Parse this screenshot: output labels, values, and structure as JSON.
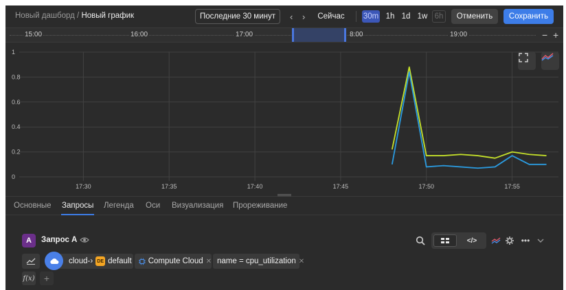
{
  "breadcrumb": {
    "parent": "Новый дашборд",
    "separator": " / ",
    "current": "Новый график"
  },
  "toolbar": {
    "range_label": "Последние 30 минут",
    "now_label": "Сейчас",
    "scales": [
      {
        "label": "30m",
        "state": "active"
      },
      {
        "label": "1h",
        "state": "on"
      },
      {
        "label": "1d",
        "state": "on"
      },
      {
        "label": "1w",
        "state": "on"
      },
      {
        "label": "6h",
        "state": "off"
      }
    ],
    "cancel_label": "Отменить",
    "save_label": "Сохранить"
  },
  "timeline": {
    "labels": [
      "15:00",
      "16:00",
      "17:00",
      "8:00",
      "19:00"
    ],
    "zoom_out": "−",
    "zoom_in": "+"
  },
  "chart_data": {
    "type": "line",
    "x": [
      "17:48",
      "17:49",
      "17:50",
      "17:51",
      "17:52",
      "17:53",
      "17:54",
      "17:55",
      "17:56",
      "17:57"
    ],
    "x_ticks": [
      "17:30",
      "17:35",
      "17:40",
      "17:45",
      "17:50",
      "17:55"
    ],
    "y_ticks": [
      "1",
      "0.8",
      "0.6",
      "0.4",
      "0.2",
      "0"
    ],
    "ylim": [
      0,
      1
    ],
    "grid": true,
    "series": [
      {
        "color": "#c6e22a",
        "values": [
          0.22,
          0.88,
          0.17,
          0.17,
          0.18,
          0.17,
          0.15,
          0.2,
          0.18,
          0.17
        ]
      },
      {
        "color": "#2b9be0",
        "values": [
          0.1,
          0.84,
          0.08,
          0.09,
          0.08,
          0.07,
          0.08,
          0.17,
          0.1,
          0.1
        ]
      }
    ]
  },
  "tabs": [
    "Основные",
    "Запросы",
    "Легенда",
    "Оси",
    "Визуализация",
    "Прореживание"
  ],
  "active_tab": "Запросы",
  "query": {
    "letter": "A",
    "name": "Запрос A",
    "cloud_chip": "cloud-›",
    "folder_badge": "DE",
    "folder_chip": "default",
    "service_chip": "Compute Cloud",
    "metric_chip": "name = cpu_utilization",
    "fx_label": "f(x)",
    "add_label": "+"
  },
  "colors": {
    "accent": "#3d7de8",
    "series_yellow": "#c6e22a",
    "series_blue": "#2b9be0"
  }
}
